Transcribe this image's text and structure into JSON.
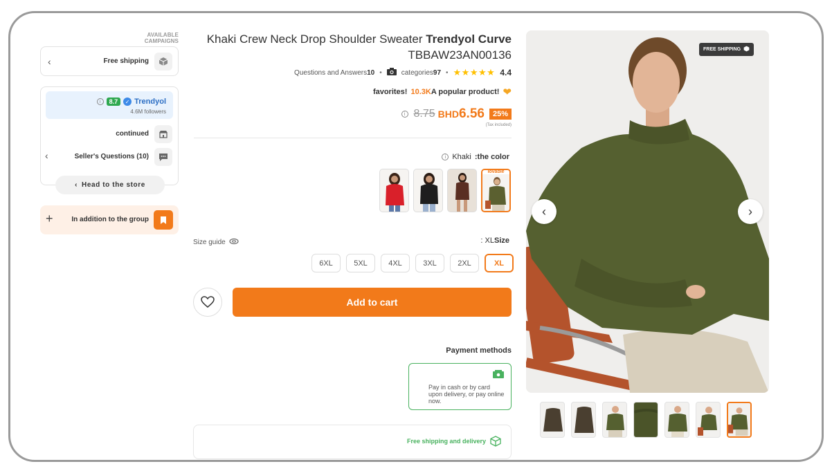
{
  "campaigns": {
    "title": "AVAILABLE CAMPAIGNS",
    "free_shipping": "Free shipping"
  },
  "seller": {
    "score": "8.7",
    "name": "Trendyol",
    "followers": "4.6M followers",
    "continued": "continued",
    "questions": "Seller's Questions (10)",
    "store_button": "Head to the store"
  },
  "group": {
    "label": "In addition to the group"
  },
  "product": {
    "title_prefix": "Khaki Crew Neck Drop Shoulder Sweater ",
    "brand": "Trendyol Curve",
    "code": "TBBAW23AN00136",
    "qa_label": "Questions and Answers",
    "qa_count": "10",
    "categories_label": "categories",
    "categories_count": "97",
    "stars": "★★★★★",
    "rating": "4.4",
    "favorites_label": "favorites!",
    "favorites_count": "10.3K",
    "popular": "A popular product!",
    "old_price": "8.75",
    "currency": "BHD",
    "new_price": "6.56",
    "discount": "25%",
    "tax_note": "(Tax included)"
  },
  "color": {
    "value": "Khaki",
    "label": ":the color",
    "swatch_tag": "lovable",
    "swatches": [
      "red",
      "black",
      "brown",
      "khaki"
    ],
    "swatch_colors": [
      "#d9202a",
      "#1e1e1e",
      "#5a2e22",
      "#5b6030"
    ]
  },
  "size": {
    "guide": "Size guide",
    "selected_value": ": XL",
    "label": "Size",
    "options": [
      "6XL",
      "5XL",
      "4XL",
      "3XL",
      "2XL",
      "XL"
    ]
  },
  "actions": {
    "add_to_cart": "Add to cart"
  },
  "payment": {
    "title": "Payment methods",
    "text": "Pay in cash or by card upon delivery, or pay online now."
  },
  "delivery": {
    "text": "Free shipping and delivery"
  },
  "gallery": {
    "badge": "FREE SHIPPING",
    "prev_icon": "‹",
    "next_icon": "›",
    "thumb_count": 7,
    "selected_thumb": 7,
    "sweater_color": "#556030",
    "chair_color": "#b4532c",
    "accent": "#f27a1a"
  }
}
